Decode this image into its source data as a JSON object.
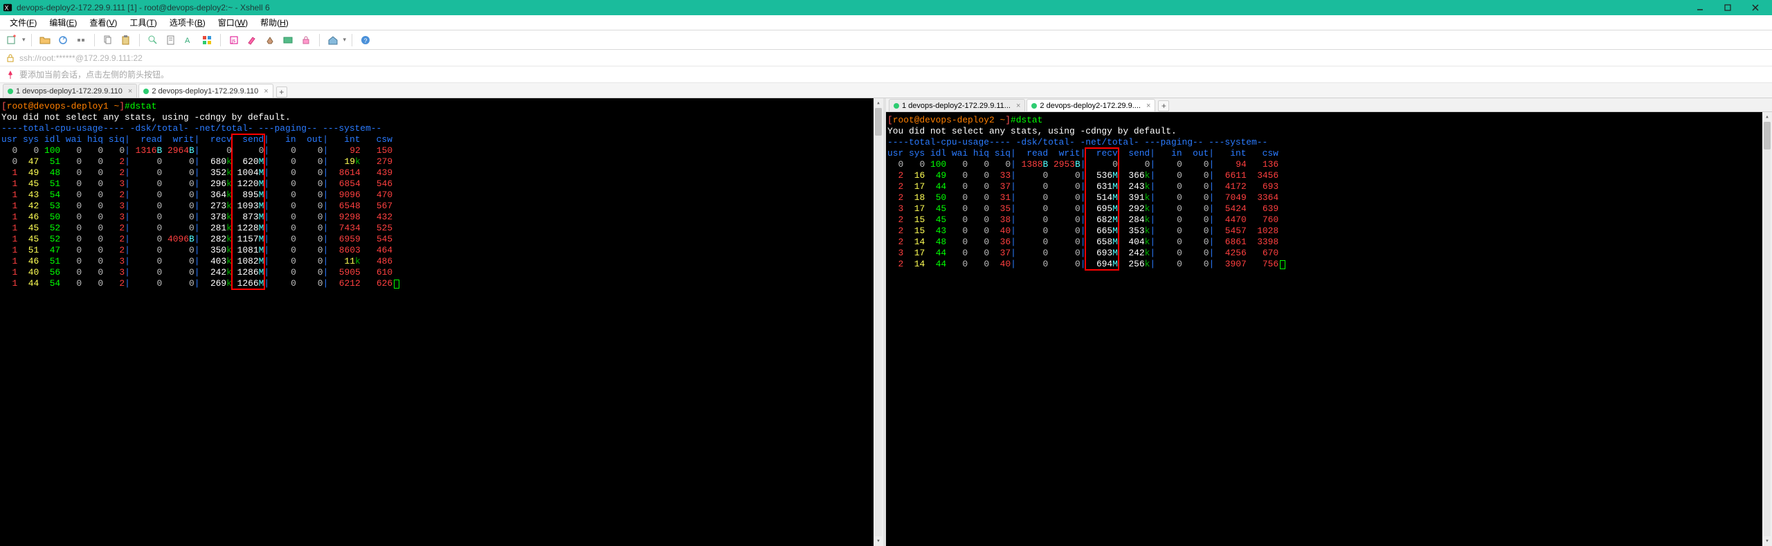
{
  "window": {
    "title": "devops-deploy2-172.29.9.111 [1] - root@devops-deploy2:~ - Xshell 6"
  },
  "menu": {
    "items": [
      {
        "pre": "文件(",
        "u": "F",
        "post": ")"
      },
      {
        "pre": "编辑(",
        "u": "E",
        "post": ")"
      },
      {
        "pre": "查看(",
        "u": "V",
        "post": ")"
      },
      {
        "pre": "工具(",
        "u": "T",
        "post": ")"
      },
      {
        "pre": "选项卡(",
        "u": "B",
        "post": ")"
      },
      {
        "pre": "窗口(",
        "u": "W",
        "post": ")"
      },
      {
        "pre": "帮助(",
        "u": "H",
        "post": ")"
      }
    ]
  },
  "addr": {
    "path": "ssh://root:******@172.29.9.111:22",
    "hint": "要添加当前会话，点击左侧的箭头按钮。"
  },
  "session_tabs": [
    {
      "label": "1 devops-deploy1-172.29.9.110",
      "active": false
    },
    {
      "label": "2 devops-deploy1-172.29.9.110",
      "active": true
    }
  ],
  "pane_left_tabs": [
    {
      "label": "1 devops-deploy2-172.29.9.11...",
      "active": false
    },
    {
      "label": "2 devops-deploy2-172.29.9....",
      "active": true
    }
  ],
  "term_left": {
    "prompt_user": "root@devops-deploy1 ~",
    "command": "#dstat",
    "note": "You did not select any stats, using -cdngy by default.",
    "header1": "----total-cpu-usage---- -dsk/total- -net/total- ---paging-- ---system--",
    "header2_cols": [
      "usr",
      "sys",
      "idl",
      "wai",
      "hiq",
      "siq",
      "read",
      "writ",
      "recv",
      "send",
      "in",
      "out",
      "int",
      "csw"
    ],
    "rows": [
      {
        "usr": "0",
        "sys": "0",
        "idl": "100",
        "wai": "0",
        "hiq": "0",
        "siq": "0",
        "read": "1316B",
        "writ": "2964B",
        "recv": "0",
        "send": "0",
        "in": "0",
        "out": "0",
        "int": "92",
        "csw": "150"
      },
      {
        "usr": "0",
        "sys": "47",
        "idl": "51",
        "wai": "0",
        "hiq": "0",
        "siq": "2",
        "read": "0",
        "writ": "0",
        "recv": "680k",
        "send": "620M",
        "in": "0",
        "out": "0",
        "int": "19k",
        "csw": "279"
      },
      {
        "usr": "1",
        "sys": "49",
        "idl": "48",
        "wai": "0",
        "hiq": "0",
        "siq": "2",
        "read": "0",
        "writ": "0",
        "recv": "352k",
        "send": "1004M",
        "in": "0",
        "out": "0",
        "int": "8614",
        "csw": "439"
      },
      {
        "usr": "1",
        "sys": "45",
        "idl": "51",
        "wai": "0",
        "hiq": "0",
        "siq": "3",
        "read": "0",
        "writ": "0",
        "recv": "296k",
        "send": "1220M",
        "in": "0",
        "out": "0",
        "int": "6854",
        "csw": "546"
      },
      {
        "usr": "1",
        "sys": "43",
        "idl": "54",
        "wai": "0",
        "hiq": "0",
        "siq": "2",
        "read": "0",
        "writ": "0",
        "recv": "364k",
        "send": "895M",
        "in": "0",
        "out": "0",
        "int": "9096",
        "csw": "470"
      },
      {
        "usr": "1",
        "sys": "42",
        "idl": "53",
        "wai": "0",
        "hiq": "0",
        "siq": "3",
        "read": "0",
        "writ": "0",
        "recv": "273k",
        "send": "1093M",
        "in": "0",
        "out": "0",
        "int": "6548",
        "csw": "567"
      },
      {
        "usr": "1",
        "sys": "46",
        "idl": "50",
        "wai": "0",
        "hiq": "0",
        "siq": "3",
        "read": "0",
        "writ": "0",
        "recv": "378k",
        "send": "873M",
        "in": "0",
        "out": "0",
        "int": "9298",
        "csw": "432"
      },
      {
        "usr": "1",
        "sys": "45",
        "idl": "52",
        "wai": "0",
        "hiq": "0",
        "siq": "2",
        "read": "0",
        "writ": "0",
        "recv": "281k",
        "send": "1228M",
        "in": "0",
        "out": "0",
        "int": "7434",
        "csw": "525"
      },
      {
        "usr": "1",
        "sys": "45",
        "idl": "52",
        "wai": "0",
        "hiq": "0",
        "siq": "2",
        "read": "0",
        "writ": "4096B",
        "recv": "282k",
        "send": "1157M",
        "in": "0",
        "out": "0",
        "int": "6959",
        "csw": "545"
      },
      {
        "usr": "1",
        "sys": "51",
        "idl": "47",
        "wai": "0",
        "hiq": "0",
        "siq": "2",
        "read": "0",
        "writ": "0",
        "recv": "350k",
        "send": "1081M",
        "in": "0",
        "out": "0",
        "int": "8603",
        "csw": "464"
      },
      {
        "usr": "1",
        "sys": "46",
        "idl": "51",
        "wai": "0",
        "hiq": "0",
        "siq": "3",
        "read": "0",
        "writ": "0",
        "recv": "403k",
        "send": "1082M",
        "in": "0",
        "out": "0",
        "int": "11k",
        "csw": "486"
      },
      {
        "usr": "1",
        "sys": "40",
        "idl": "56",
        "wai": "0",
        "hiq": "0",
        "siq": "3",
        "read": "0",
        "writ": "0",
        "recv": "242k",
        "send": "1286M",
        "in": "0",
        "out": "0",
        "int": "5905",
        "csw": "610"
      },
      {
        "usr": "1",
        "sys": "44",
        "idl": "54",
        "wai": "0",
        "hiq": "0",
        "siq": "2",
        "read": "0",
        "writ": "0",
        "recv": "269k",
        "send": "1266M",
        "in": "0",
        "out": "0",
        "int": "6212",
        "csw": "626"
      }
    ],
    "cursor_row": 12,
    "hl_col": "send"
  },
  "term_right": {
    "prompt_user": "root@devops-deploy2 ~",
    "command": "#dstat",
    "note": "You did not select any stats, using -cdngy by default.",
    "header1": "----total-cpu-usage---- -dsk/total- -net/total- ---paging-- ---system--",
    "header2_cols": [
      "usr",
      "sys",
      "idl",
      "wai",
      "hiq",
      "siq",
      "read",
      "writ",
      "recv",
      "send",
      "in",
      "out",
      "int",
      "csw"
    ],
    "rows": [
      {
        "usr": "0",
        "sys": "0",
        "idl": "100",
        "wai": "0",
        "hiq": "0",
        "siq": "0",
        "read": "1388B",
        "writ": "2953B",
        "recv": "0",
        "send": "0",
        "in": "0",
        "out": "0",
        "int": "94",
        "csw": "136"
      },
      {
        "usr": "2",
        "sys": "16",
        "idl": "49",
        "wai": "0",
        "hiq": "0",
        "siq": "33",
        "read": "0",
        "writ": "0",
        "recv": "536M",
        "send": "366k",
        "in": "0",
        "out": "0",
        "int": "6611",
        "csw": "3456"
      },
      {
        "usr": "2",
        "sys": "17",
        "idl": "44",
        "wai": "0",
        "hiq": "0",
        "siq": "37",
        "read": "0",
        "writ": "0",
        "recv": "631M",
        "send": "243k",
        "in": "0",
        "out": "0",
        "int": "4172",
        "csw": "693"
      },
      {
        "usr": "2",
        "sys": "18",
        "idl": "50",
        "wai": "0",
        "hiq": "0",
        "siq": "31",
        "read": "0",
        "writ": "0",
        "recv": "514M",
        "send": "391k",
        "in": "0",
        "out": "0",
        "int": "7049",
        "csw": "3364"
      },
      {
        "usr": "3",
        "sys": "17",
        "idl": "45",
        "wai": "0",
        "hiq": "0",
        "siq": "35",
        "read": "0",
        "writ": "0",
        "recv": "695M",
        "send": "292k",
        "in": "0",
        "out": "0",
        "int": "5424",
        "csw": "639"
      },
      {
        "usr": "2",
        "sys": "15",
        "idl": "45",
        "wai": "0",
        "hiq": "0",
        "siq": "38",
        "read": "0",
        "writ": "0",
        "recv": "682M",
        "send": "284k",
        "in": "0",
        "out": "0",
        "int": "4470",
        "csw": "760"
      },
      {
        "usr": "2",
        "sys": "15",
        "idl": "43",
        "wai": "0",
        "hiq": "0",
        "siq": "40",
        "read": "0",
        "writ": "0",
        "recv": "665M",
        "send": "353k",
        "in": "0",
        "out": "0",
        "int": "5457",
        "csw": "1028"
      },
      {
        "usr": "2",
        "sys": "14",
        "idl": "48",
        "wai": "0",
        "hiq": "0",
        "siq": "36",
        "read": "0",
        "writ": "0",
        "recv": "658M",
        "send": "404k",
        "in": "0",
        "out": "0",
        "int": "6861",
        "csw": "3398"
      },
      {
        "usr": "3",
        "sys": "17",
        "idl": "44",
        "wai": "0",
        "hiq": "0",
        "siq": "37",
        "read": "0",
        "writ": "0",
        "recv": "693M",
        "send": "242k",
        "in": "0",
        "out": "0",
        "int": "4256",
        "csw": "670"
      },
      {
        "usr": "2",
        "sys": "14",
        "idl": "44",
        "wai": "0",
        "hiq": "0",
        "siq": "40",
        "read": "0",
        "writ": "0",
        "recv": "694M",
        "send": "256k",
        "in": "0",
        "out": "0",
        "int": "3907",
        "csw": "756"
      }
    ],
    "cursor_row": 9,
    "hl_col": "recv"
  }
}
